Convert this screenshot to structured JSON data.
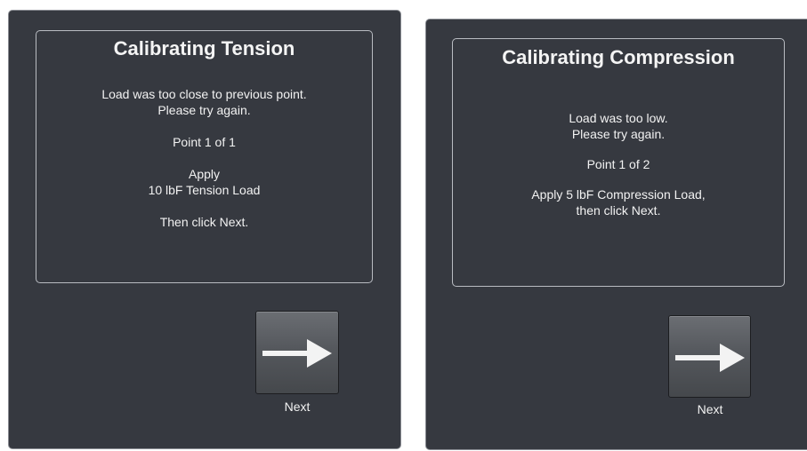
{
  "left": {
    "title": "Calibrating Tension",
    "lines": [
      "Load was too close to previous point.",
      "Please try again.",
      "",
      "Point 1 of 1",
      "",
      "Apply",
      "10 lbF Tension Load",
      "",
      "Then click Next."
    ],
    "next_label": "Next",
    "next_icon": "arrow-right-icon"
  },
  "right": {
    "title": "Calibrating Compression",
    "lines": [
      "Load was too low.",
      "Please try again.",
      "",
      "Point 1 of 2",
      "",
      "Apply 5 lbF Compression Load,",
      "then click Next."
    ],
    "next_label": "Next",
    "next_icon": "arrow-right-icon"
  },
  "colors": {
    "background": "#363940",
    "panel_border": "#b9bcc2",
    "text": "#f2f2f2"
  }
}
